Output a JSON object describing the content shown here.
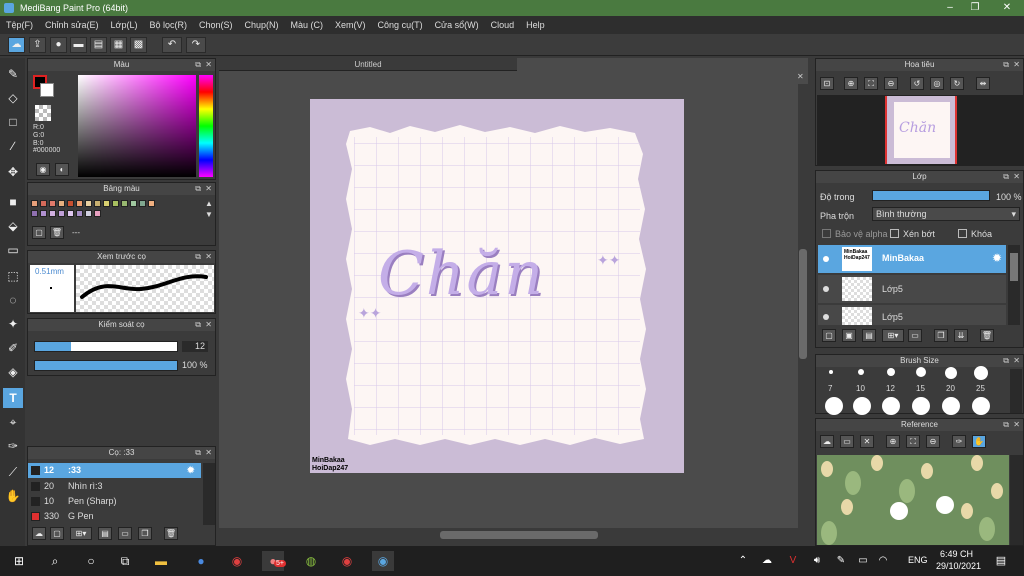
{
  "window": {
    "title": "MediBang Paint Pro (64bit)"
  },
  "menu": [
    "Tệp(F)",
    "Chỉnh sửa(E)",
    "Lớp(L)",
    "Bộ lọc(R)",
    "Chọn(S)",
    "Chụp(N)",
    "Màu (C)",
    "Xem(V)",
    "Công cụ(T)",
    "Cửa sổ(W)",
    "Cloud",
    "Help"
  ],
  "color_panel": {
    "title": "Màu",
    "r": "R:0",
    "g": "G:0",
    "b": "B:0",
    "hex": "#000000"
  },
  "palette_panel": {
    "title": "Bảng màu",
    "dash": "---",
    "row1": [
      "#e8a07a",
      "#d46a5a",
      "#e07a6a",
      "#e8b080",
      "#c85030",
      "#f0a070",
      "#e8d0a0",
      "#c8b070",
      "#d8d070",
      "#a8c060",
      "#98b870",
      "#a0c8a0",
      "#80a890",
      "#f0b080"
    ],
    "row2": [
      "#9070b0",
      "#b090d0",
      "#d0b0e0",
      "#c0a0d8",
      "#e0c8f0",
      "#a890c8",
      "#d0d0e0",
      "#e8a0c0"
    ]
  },
  "preview_panel": {
    "title": "Xem trước cọ",
    "size": "0.51mm"
  },
  "brush_control": {
    "title": "Kiểm soát cọ",
    "size_value": "12",
    "opacity_value": "100 %",
    "size_fill": 0.25,
    "opacity_fill": 1.0
  },
  "brush_list": {
    "title": "Cọ: :33",
    "items": [
      {
        "size": "12",
        "name": ":33",
        "color": "#222222"
      },
      {
        "size": "20",
        "name": "Nhìn rì:3",
        "color": "#222222"
      },
      {
        "size": "10",
        "name": "Pen (Sharp)",
        "color": "#222222"
      },
      {
        "size": "330",
        "name": "G Pen",
        "color": "#e03030"
      }
    ]
  },
  "canvas": {
    "tab": "Untitled",
    "artwork_text": "Chăn",
    "signature_line1": "MinBakaa",
    "signature_line2": "HoiDap247"
  },
  "navigator": {
    "title": "Hoa tiêu",
    "thumb_text": "Chăn"
  },
  "layers": {
    "title": "Lớp",
    "opacity_label": "Độ trong",
    "opacity_value": "100 %",
    "opacity_fill": 1.0,
    "blend_label": "Pha trộn",
    "blend_value": "Bình thường",
    "protect_alpha": "Bảo vệ alpha",
    "clipping": "Xén bớt",
    "lock": "Khóa",
    "items": [
      {
        "name": "MinBakaa",
        "thumb": "MinBakaa HoiDap247"
      },
      {
        "name": "Lớp5"
      },
      {
        "name": "Lớp5"
      }
    ]
  },
  "brush_size": {
    "title": "Brush Size",
    "sizes": [
      "7",
      "10",
      "12",
      "15",
      "20",
      "25"
    ]
  },
  "reference": {
    "title": "Reference"
  },
  "taskbar": {
    "time": "6:49 CH",
    "date": "29/10/2021",
    "lang": "ENG",
    "badge": "5+"
  }
}
